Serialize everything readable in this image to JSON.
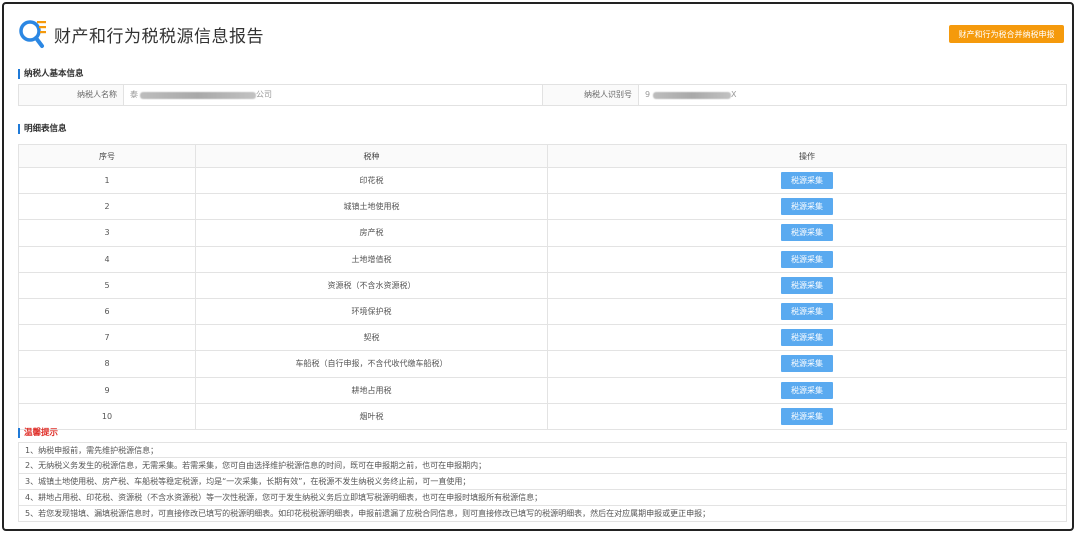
{
  "header": {
    "title": "财产和行为税税源信息报告",
    "merge_button": "财产和行为税合并纳税申报"
  },
  "taxpayer": {
    "section_title": "纳税人基本信息",
    "name_label": "纳税人名称",
    "name_value_prefix": "泰",
    "name_value_suffix": "公司",
    "id_label": "纳税人识别号",
    "id_value_prefix": "9",
    "id_value_suffix": "X"
  },
  "detail": {
    "section_title": "明细表信息",
    "columns": [
      "序号",
      "税种",
      "操作"
    ],
    "button_label": "税源采集",
    "rows": [
      {
        "no": "1",
        "tax": "印花税"
      },
      {
        "no": "2",
        "tax": "城镇土地使用税"
      },
      {
        "no": "3",
        "tax": "房产税"
      },
      {
        "no": "4",
        "tax": "土地增值税"
      },
      {
        "no": "5",
        "tax": "资源税（不含水资源税）"
      },
      {
        "no": "6",
        "tax": "环境保护税"
      },
      {
        "no": "7",
        "tax": "契税"
      },
      {
        "no": "8",
        "tax": "车船税（自行申报，不含代收代缴车船税）"
      },
      {
        "no": "9",
        "tax": "耕地占用税"
      },
      {
        "no": "10",
        "tax": "烟叶税"
      }
    ]
  },
  "tips": {
    "section_title": "温馨提示",
    "items": [
      "1、纳税申报前，需先维护税源信息；",
      "2、无纳税义务发生的税源信息，无需采集。若需采集，您可自由选择维护税源信息的时间，既可在申报期之前，也可在申报期内；",
      "3、城镇土地使用税、房产税、车船税等稳定税源，均是“一次采集，长期有效”，在税源不发生纳税义务终止前，可一直使用；",
      "4、耕地占用税、印花税、资源税（不含水资源税）等一次性税源，您可于发生纳税义务后立即填写税源明细表，也可在申报时填报所有税源信息；",
      "5、若您发现错填、漏填税源信息时，可直接修改已填写的税源明细表。如印花税税源明细表，申报前遗漏了应税合同信息，则可直接修改已填写的税源明细表，然后在对应属期申报或更正申报；"
    ]
  },
  "colors": {
    "accent": "#1f7ad8",
    "button_blue": "#5aaaf0",
    "button_orange": "#f59a0c",
    "tip_red": "#e0302a"
  }
}
